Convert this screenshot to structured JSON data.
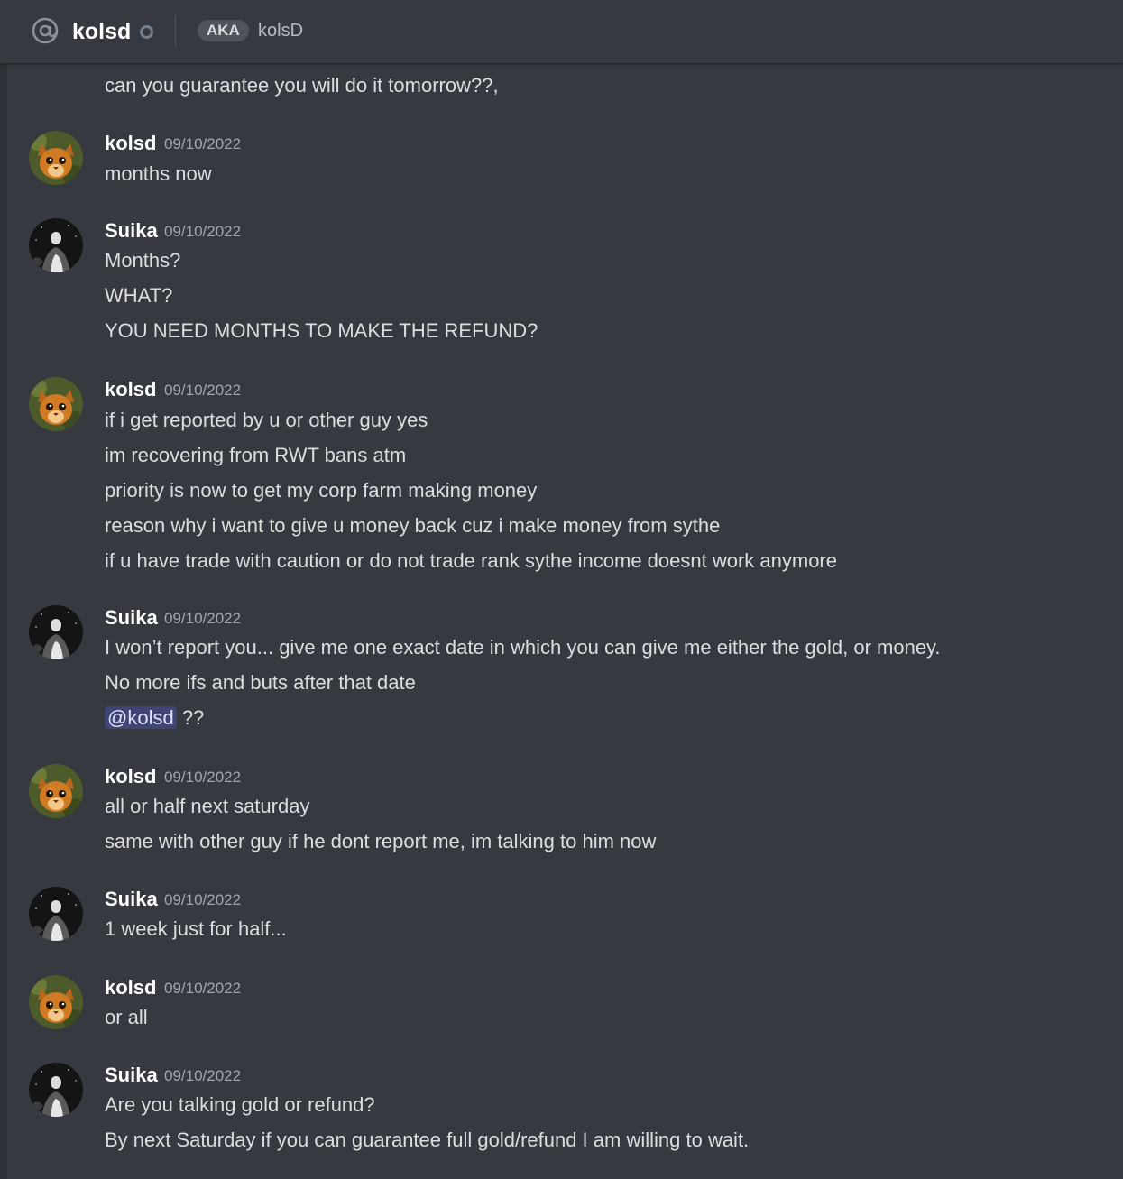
{
  "header": {
    "channel_name": "kolsd",
    "aka_label": "AKA",
    "aka_name": "kolsD"
  },
  "messages": {
    "m0": {
      "lines": [
        "can you guarantee you will do it tomorrow??,"
      ]
    },
    "m1": {
      "author": "kolsd",
      "timestamp": "09/10/2022",
      "lines": [
        "months  now"
      ]
    },
    "m2": {
      "author": "Suika",
      "timestamp": "09/10/2022",
      "lines": [
        "Months?",
        "WHAT?",
        "YOU NEED MONTHS TO MAKE THE REFUND?"
      ]
    },
    "m3": {
      "author": "kolsd",
      "timestamp": "09/10/2022",
      "lines": [
        "if i get reported by u or other guy yes",
        "im recovering from RWT bans atm",
        "priority is now to get my corp farm making money",
        "reason why i want to give u money back cuz i make money from sythe",
        "if u have trade with caution or do not trade rank sythe income doesnt work anymore"
      ]
    },
    "m4": {
      "author": "Suika",
      "timestamp": "09/10/2022",
      "lines": [
        "I won’t report you... give me one exact date in which you can give me either the gold, or money.",
        "No more ifs and buts after that date"
      ],
      "mention": "@kolsd",
      "mention_suffix": " ??"
    },
    "m5": {
      "author": "kolsd",
      "timestamp": "09/10/2022",
      "lines": [
        "all or half next saturday",
        "same with other guy if he dont report me, im talking to him now"
      ]
    },
    "m6": {
      "author": "Suika",
      "timestamp": "09/10/2022",
      "lines": [
        "1 week just for half..."
      ]
    },
    "m7": {
      "author": "kolsd",
      "timestamp": "09/10/2022",
      "lines": [
        "or all"
      ]
    },
    "m8": {
      "author": "Suika",
      "timestamp": "09/10/2022",
      "lines": [
        "Are you talking gold or refund?",
        "By next Saturday if you can guarantee full gold/refund I am willing to wait."
      ]
    }
  },
  "colors": {
    "background": "#36393f",
    "text": "#dcddde",
    "author": "#ffffff",
    "timestamp": "#a3a6aa",
    "mention_bg": "#5865f2"
  },
  "icons": {
    "header": "at-icon",
    "status": "offline-status-icon"
  }
}
